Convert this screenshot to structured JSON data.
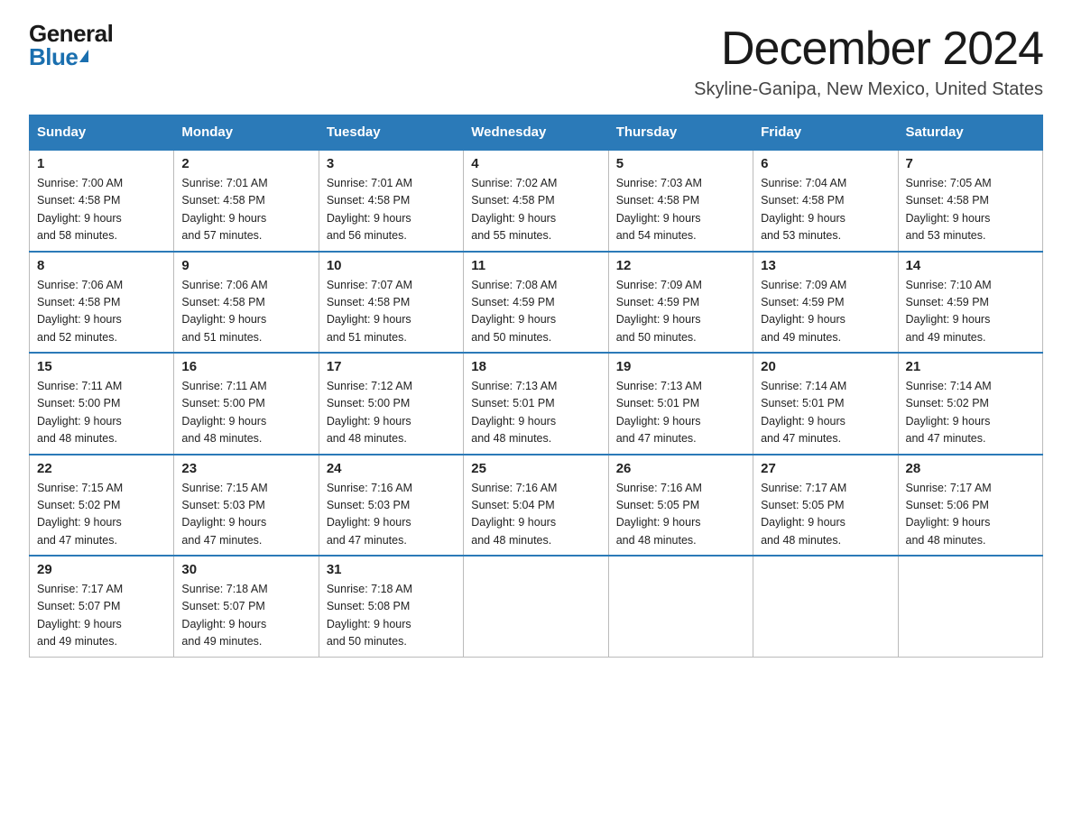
{
  "logo": {
    "general": "General",
    "blue": "Blue"
  },
  "header": {
    "month": "December 2024",
    "location": "Skyline-Ganipa, New Mexico, United States"
  },
  "weekdays": [
    "Sunday",
    "Monday",
    "Tuesday",
    "Wednesday",
    "Thursday",
    "Friday",
    "Saturday"
  ],
  "weeks": [
    [
      {
        "day": "1",
        "sunrise": "7:00 AM",
        "sunset": "4:58 PM",
        "daylight": "9 hours and 58 minutes."
      },
      {
        "day": "2",
        "sunrise": "7:01 AM",
        "sunset": "4:58 PM",
        "daylight": "9 hours and 57 minutes."
      },
      {
        "day": "3",
        "sunrise": "7:01 AM",
        "sunset": "4:58 PM",
        "daylight": "9 hours and 56 minutes."
      },
      {
        "day": "4",
        "sunrise": "7:02 AM",
        "sunset": "4:58 PM",
        "daylight": "9 hours and 55 minutes."
      },
      {
        "day": "5",
        "sunrise": "7:03 AM",
        "sunset": "4:58 PM",
        "daylight": "9 hours and 54 minutes."
      },
      {
        "day": "6",
        "sunrise": "7:04 AM",
        "sunset": "4:58 PM",
        "daylight": "9 hours and 53 minutes."
      },
      {
        "day": "7",
        "sunrise": "7:05 AM",
        "sunset": "4:58 PM",
        "daylight": "9 hours and 53 minutes."
      }
    ],
    [
      {
        "day": "8",
        "sunrise": "7:06 AM",
        "sunset": "4:58 PM",
        "daylight": "9 hours and 52 minutes."
      },
      {
        "day": "9",
        "sunrise": "7:06 AM",
        "sunset": "4:58 PM",
        "daylight": "9 hours and 51 minutes."
      },
      {
        "day": "10",
        "sunrise": "7:07 AM",
        "sunset": "4:58 PM",
        "daylight": "9 hours and 51 minutes."
      },
      {
        "day": "11",
        "sunrise": "7:08 AM",
        "sunset": "4:59 PM",
        "daylight": "9 hours and 50 minutes."
      },
      {
        "day": "12",
        "sunrise": "7:09 AM",
        "sunset": "4:59 PM",
        "daylight": "9 hours and 50 minutes."
      },
      {
        "day": "13",
        "sunrise": "7:09 AM",
        "sunset": "4:59 PM",
        "daylight": "9 hours and 49 minutes."
      },
      {
        "day": "14",
        "sunrise": "7:10 AM",
        "sunset": "4:59 PM",
        "daylight": "9 hours and 49 minutes."
      }
    ],
    [
      {
        "day": "15",
        "sunrise": "7:11 AM",
        "sunset": "5:00 PM",
        "daylight": "9 hours and 48 minutes."
      },
      {
        "day": "16",
        "sunrise": "7:11 AM",
        "sunset": "5:00 PM",
        "daylight": "9 hours and 48 minutes."
      },
      {
        "day": "17",
        "sunrise": "7:12 AM",
        "sunset": "5:00 PM",
        "daylight": "9 hours and 48 minutes."
      },
      {
        "day": "18",
        "sunrise": "7:13 AM",
        "sunset": "5:01 PM",
        "daylight": "9 hours and 48 minutes."
      },
      {
        "day": "19",
        "sunrise": "7:13 AM",
        "sunset": "5:01 PM",
        "daylight": "9 hours and 47 minutes."
      },
      {
        "day": "20",
        "sunrise": "7:14 AM",
        "sunset": "5:01 PM",
        "daylight": "9 hours and 47 minutes."
      },
      {
        "day": "21",
        "sunrise": "7:14 AM",
        "sunset": "5:02 PM",
        "daylight": "9 hours and 47 minutes."
      }
    ],
    [
      {
        "day": "22",
        "sunrise": "7:15 AM",
        "sunset": "5:02 PM",
        "daylight": "9 hours and 47 minutes."
      },
      {
        "day": "23",
        "sunrise": "7:15 AM",
        "sunset": "5:03 PM",
        "daylight": "9 hours and 47 minutes."
      },
      {
        "day": "24",
        "sunrise": "7:16 AM",
        "sunset": "5:03 PM",
        "daylight": "9 hours and 47 minutes."
      },
      {
        "day": "25",
        "sunrise": "7:16 AM",
        "sunset": "5:04 PM",
        "daylight": "9 hours and 48 minutes."
      },
      {
        "day": "26",
        "sunrise": "7:16 AM",
        "sunset": "5:05 PM",
        "daylight": "9 hours and 48 minutes."
      },
      {
        "day": "27",
        "sunrise": "7:17 AM",
        "sunset": "5:05 PM",
        "daylight": "9 hours and 48 minutes."
      },
      {
        "day": "28",
        "sunrise": "7:17 AM",
        "sunset": "5:06 PM",
        "daylight": "9 hours and 48 minutes."
      }
    ],
    [
      {
        "day": "29",
        "sunrise": "7:17 AM",
        "sunset": "5:07 PM",
        "daylight": "9 hours and 49 minutes."
      },
      {
        "day": "30",
        "sunrise": "7:18 AM",
        "sunset": "5:07 PM",
        "daylight": "9 hours and 49 minutes."
      },
      {
        "day": "31",
        "sunrise": "7:18 AM",
        "sunset": "5:08 PM",
        "daylight": "9 hours and 50 minutes."
      },
      null,
      null,
      null,
      null
    ]
  ],
  "labels": {
    "sunrise": "Sunrise:",
    "sunset": "Sunset:",
    "daylight": "Daylight:"
  }
}
